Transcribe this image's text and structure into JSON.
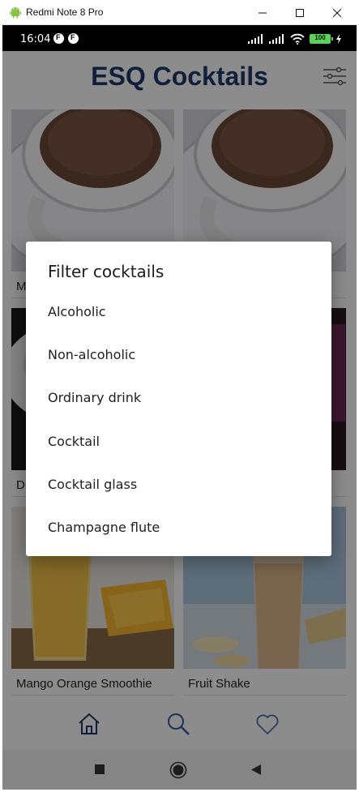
{
  "window": {
    "title": "Redmi Note 8 Pro"
  },
  "status_bar": {
    "time": "16:04",
    "notif_icon": "F",
    "battery": "100"
  },
  "app": {
    "title": "ESQ Cocktails"
  },
  "grid": {
    "cards": [
      {
        "caption": "M"
      },
      {
        "caption": ""
      },
      {
        "caption": "Dr"
      },
      {
        "caption": ""
      },
      {
        "caption": "Mango Orange Smoothie"
      },
      {
        "caption": "Fruit Shake"
      }
    ]
  },
  "dialog": {
    "title": "Filter cocktails",
    "options": [
      "Alcoholic",
      "Non-alcoholic",
      "Ordinary drink",
      "Cocktail",
      "Cocktail glass",
      "Champagne flute"
    ]
  },
  "bottom_nav": {
    "items": [
      "home-icon",
      "search-icon",
      "heart-icon"
    ],
    "active": "home-icon"
  },
  "colors": {
    "accent": "#1e3a6b",
    "scrim": "#000000"
  }
}
